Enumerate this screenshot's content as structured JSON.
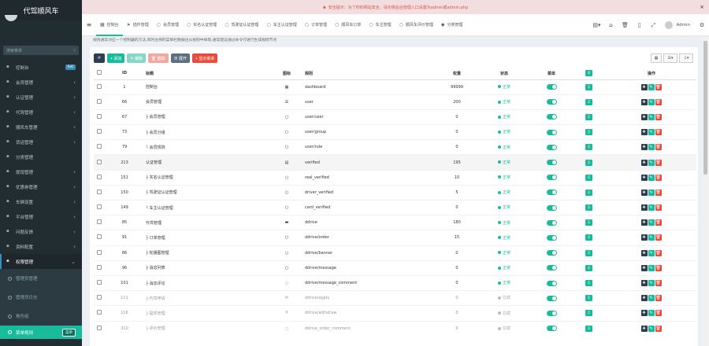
{
  "app": {
    "title": "代驾顺风车"
  },
  "alert": {
    "text": "安全提示：为了你的网站安全，请勿将后台管理入口设置为admin或admin.php",
    "close": "×"
  },
  "sidebar": {
    "search_placeholder": "搜索菜单",
    "items": [
      {
        "label": "控制台",
        "badge": "hot"
      },
      {
        "label": "会员管理"
      },
      {
        "label": "认证管理"
      },
      {
        "label": "代驾管理"
      },
      {
        "label": "顺风车管理"
      },
      {
        "label": "货运管理"
      },
      {
        "label": "分类管理"
      },
      {
        "label": "提现管理"
      },
      {
        "label": "优惠券管理"
      },
      {
        "label": "车辆设置"
      },
      {
        "label": "平台管理"
      },
      {
        "label": "问题反馈"
      },
      {
        "label": "资料配置"
      },
      {
        "label": "权限管理"
      }
    ],
    "subitems": [
      {
        "label": "管理员管理"
      },
      {
        "label": "管理员日志"
      },
      {
        "label": "角色组"
      },
      {
        "label": "菜单规则",
        "badge": "菜单"
      }
    ]
  },
  "topnav": {
    "tabs": [
      {
        "icon": "▦",
        "label": "控制台"
      },
      {
        "icon": "➤",
        "label": "插件管理"
      },
      {
        "icon": "○",
        "label": "会员管理"
      },
      {
        "icon": "○",
        "label": "实名认证管理"
      },
      {
        "icon": "○",
        "label": "驾驶证认证管理"
      },
      {
        "icon": "○",
        "label": "车主认证管理"
      },
      {
        "icon": "○",
        "label": "订单管理"
      },
      {
        "icon": "○",
        "label": "顺风车订单"
      },
      {
        "icon": "○",
        "label": "车主管理"
      },
      {
        "icon": "○",
        "label": "顺风车评价管理"
      },
      {
        "icon": "◆",
        "label": "分类管理"
      }
    ],
    "admin": "Admin"
  },
  "notice": "规则通常对应一个控制器的方法,同时左侧的菜单栏数据也从规则中体现,通常建议通过命令行进行生成规则节点",
  "toolbar": {
    "refresh": "⟳",
    "add": "+ 添加",
    "edit": "✎ 编辑",
    "delete": "🗑 删除",
    "expand": "⊕ 展开",
    "show_menu": "+ 显示菜单"
  },
  "table": {
    "headers": {
      "id": "ID",
      "title": "标题",
      "icon": "图标",
      "rule": "规则",
      "weigh": "权重",
      "status": "状态",
      "menu": "菜单",
      "op": "操作"
    },
    "rows": [
      {
        "id": "1",
        "title": "控制台",
        "icon": "▦",
        "rule": "dashboard",
        "weigh": "99999",
        "status": "正常"
      },
      {
        "id": "66",
        "title": "会员管理",
        "icon": "☰",
        "rule": "user",
        "weigh": "200",
        "status": "正常"
      },
      {
        "id": "67",
        "title": "├ 会员管理",
        "icon": "○",
        "rule": "user/user",
        "weigh": "0",
        "status": "正常"
      },
      {
        "id": "73",
        "title": "├ 会员分组",
        "icon": "○",
        "rule": "user/group",
        "weigh": "0",
        "status": "正常"
      },
      {
        "id": "79",
        "title": "└ 会员规则",
        "icon": "○",
        "rule": "user/rule",
        "weigh": "0",
        "status": "正常"
      },
      {
        "id": "213",
        "title": "认证管理",
        "icon": "▤",
        "rule": "verified",
        "weigh": "195",
        "status": "正常"
      },
      {
        "id": "151",
        "title": "├ 实名认证管理",
        "icon": "○",
        "rule": "real_verified",
        "weigh": "10",
        "status": "正常"
      },
      {
        "id": "150",
        "title": "├ 驾驶证认证管理",
        "icon": "○",
        "rule": "driver_verified",
        "weigh": "5",
        "status": "正常"
      },
      {
        "id": "149",
        "title": "└ 车主认证管理",
        "icon": "○",
        "rule": "card_verified",
        "weigh": "0",
        "status": "正常"
      },
      {
        "id": "85",
        "title": "代驾管理",
        "icon": "▬",
        "rule": "ddrive",
        "weigh": "180",
        "status": "正常"
      },
      {
        "id": "91",
        "title": "├ 订单管理",
        "icon": "○",
        "rule": "ddrive/order",
        "weigh": "15",
        "status": "正常"
      },
      {
        "id": "86",
        "title": "├ 轮播图管理",
        "icon": "○",
        "rule": "ddrive/banner",
        "weigh": "0",
        "status": "正常"
      },
      {
        "id": "96",
        "title": "├ 消息列表",
        "icon": "○",
        "rule": "ddrive/message",
        "weigh": "0",
        "status": "正常"
      },
      {
        "id": "101",
        "title": "├ 消息评论",
        "icon": "◌",
        "rule": "ddrive/message_comment",
        "weigh": "0",
        "status": "正常"
      },
      {
        "id": "111",
        "title": "├ 代驾申请",
        "icon": "✉",
        "rule": "ddrive/apply",
        "weigh": "0",
        "status": "隐藏"
      },
      {
        "id": "116",
        "title": "├ 提现管理",
        "icon": "¥",
        "rule": "ddrive/withdraw",
        "weigh": "0",
        "status": "隐藏"
      },
      {
        "id": "310",
        "title": "├ 评价管理",
        "icon": "○",
        "rule": "ddrive_order_comment",
        "weigh": "0",
        "status": "隐藏"
      }
    ]
  }
}
